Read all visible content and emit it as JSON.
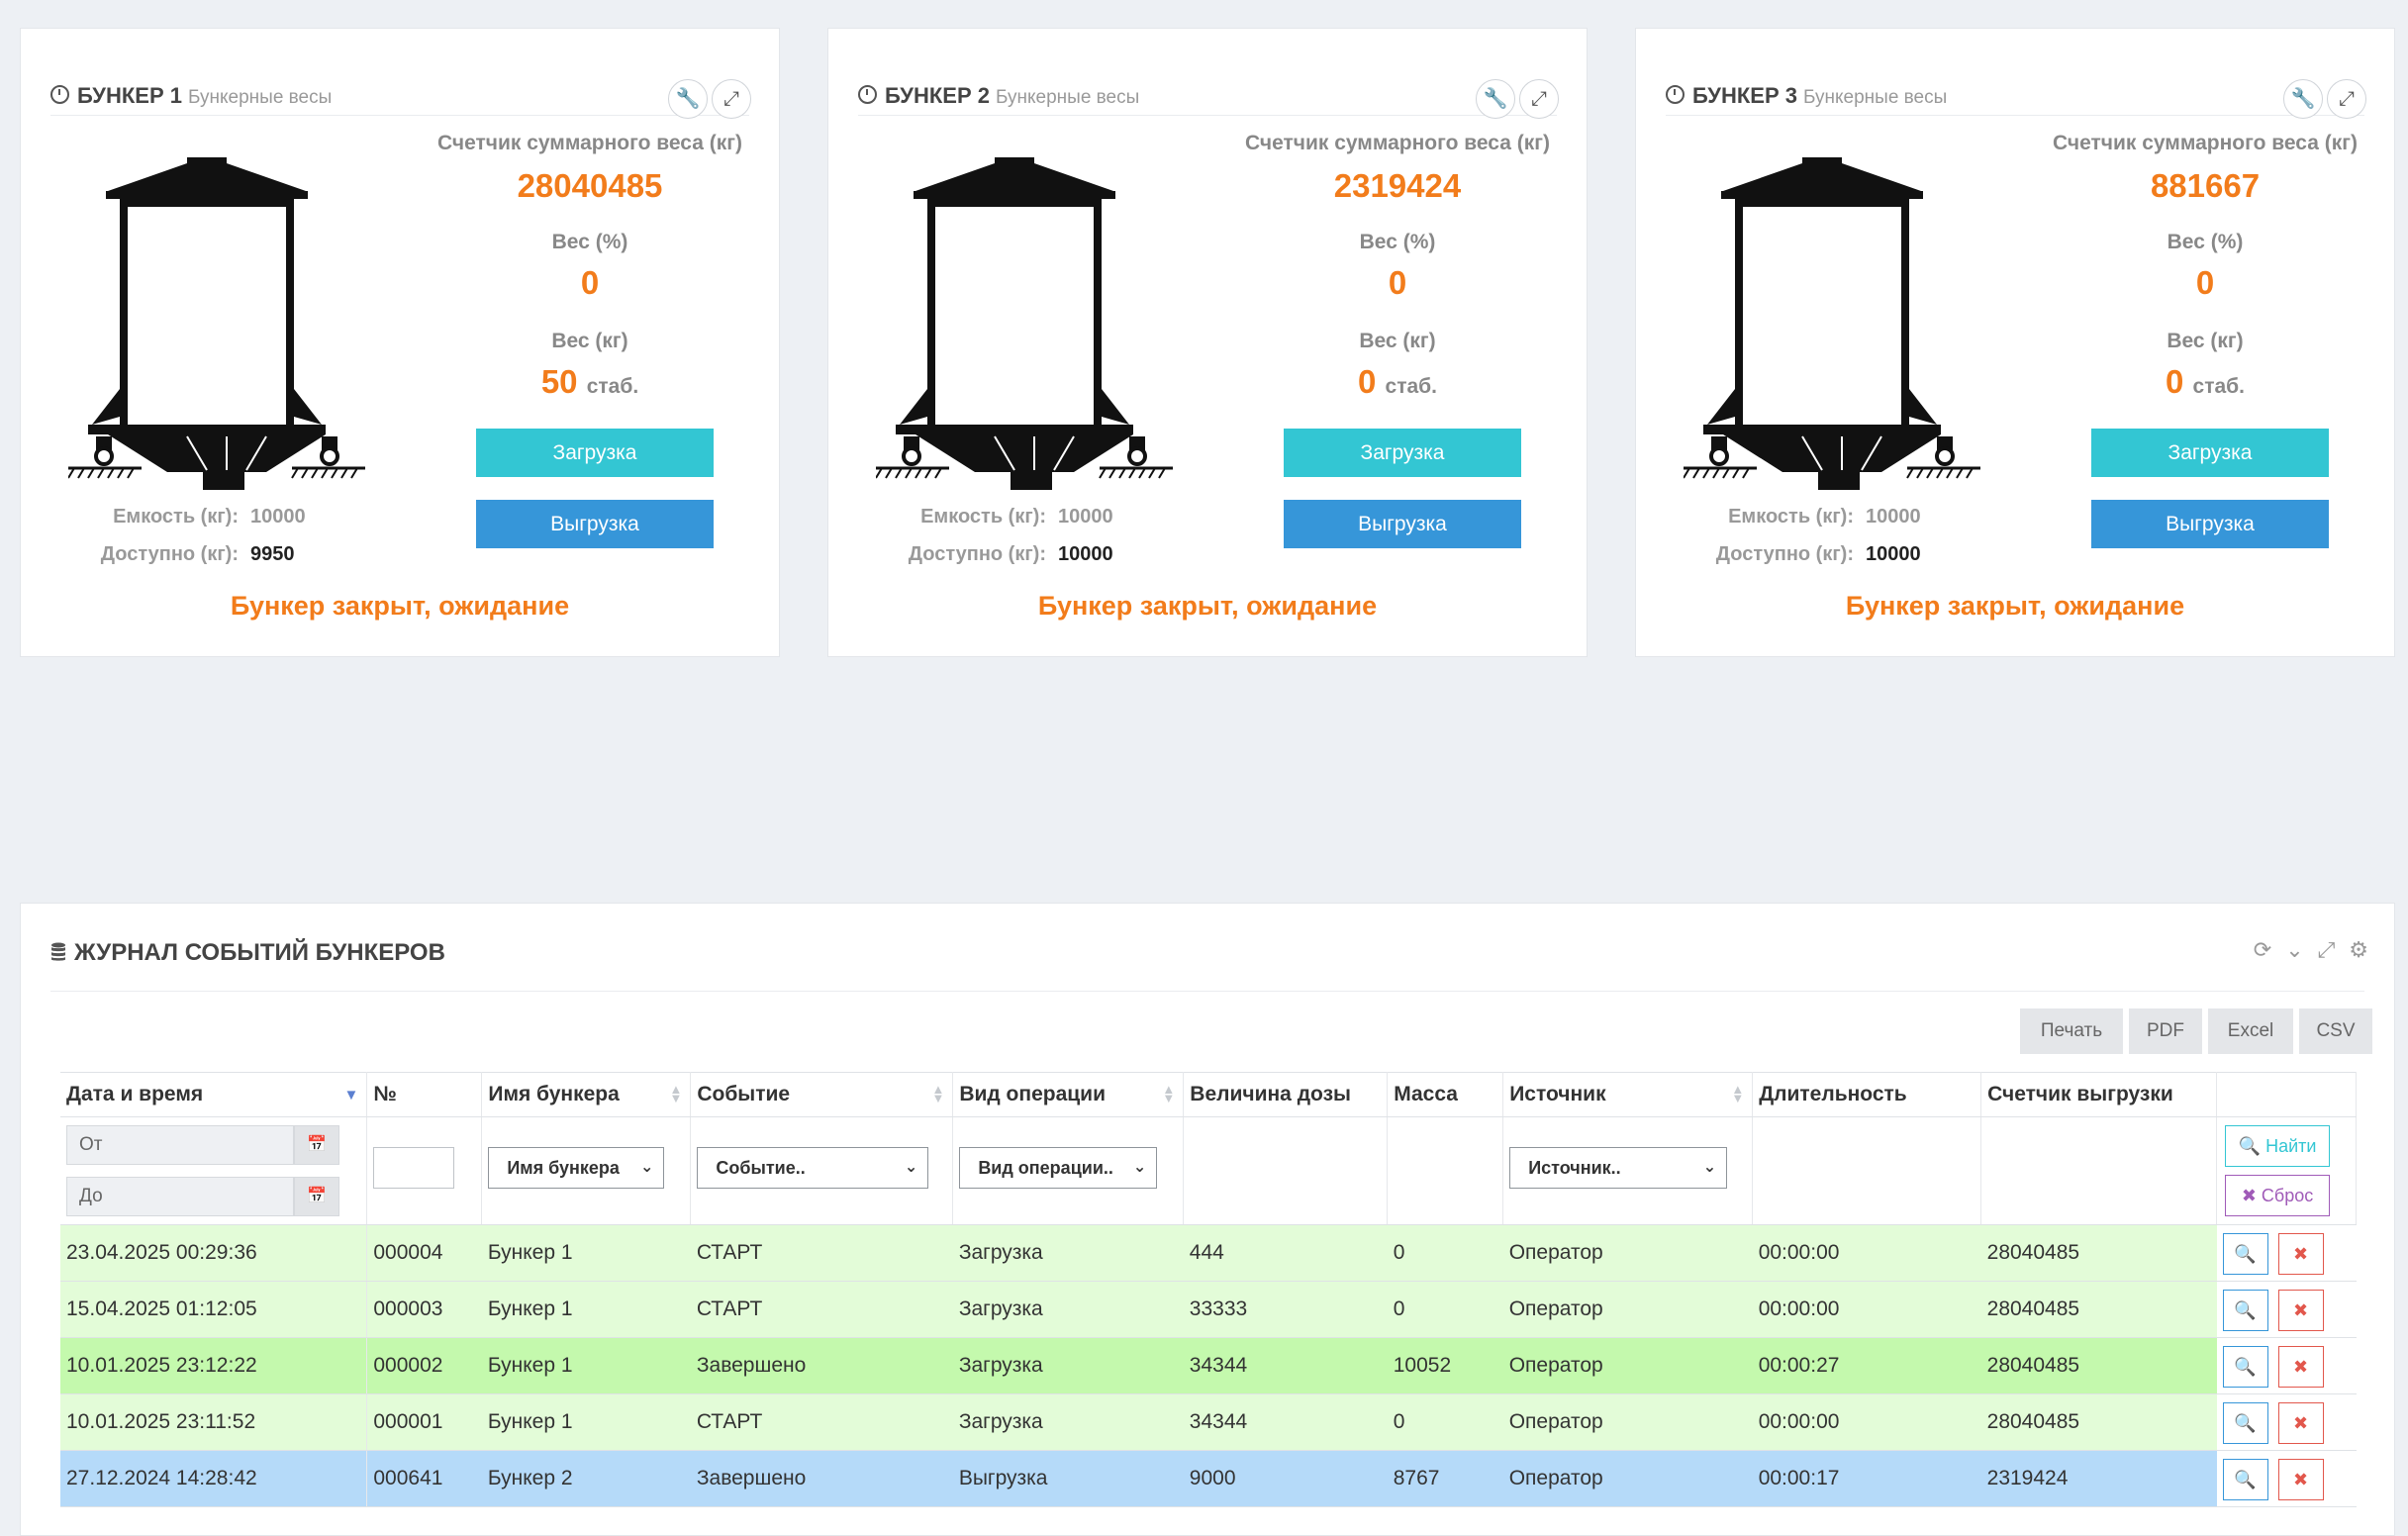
{
  "bunkers": [
    {
      "title": "БУНКЕР 1",
      "subtitle": "Бункерные весы",
      "counter_label": "Счетчик суммарного веса (кг)",
      "counter_value": "28040485",
      "pct_label": "Вес (%)",
      "pct_value": "0",
      "kg_label": "Вес (кг)",
      "kg_value": "50",
      "stab": "стаб.",
      "load_label": "Загрузка",
      "unload_label": "Выгрузка",
      "capacity_label": "Емкость (кг):",
      "capacity_value": "10000",
      "available_label": "Доступно (кг):",
      "available_value": "9950",
      "status": "Бункер закрыт, ожидание"
    },
    {
      "title": "БУНКЕР 2",
      "subtitle": "Бункерные весы",
      "counter_label": "Счетчик суммарного веса (кг)",
      "counter_value": "2319424",
      "pct_label": "Вес (%)",
      "pct_value": "0",
      "kg_label": "Вес (кг)",
      "kg_value": "0",
      "stab": "стаб.",
      "load_label": "Загрузка",
      "unload_label": "Выгрузка",
      "capacity_label": "Емкость (кг):",
      "capacity_value": "10000",
      "available_label": "Доступно (кг):",
      "available_value": "10000",
      "status": "Бункер закрыт, ожидание"
    },
    {
      "title": "БУНКЕР 3",
      "subtitle": "Бункерные весы",
      "counter_label": "Счетчик суммарного веса (кг)",
      "counter_value": "881667",
      "pct_label": "Вес (%)",
      "pct_value": "0",
      "kg_label": "Вес (кг)",
      "kg_value": "0",
      "stab": "стаб.",
      "load_label": "Загрузка",
      "unload_label": "Выгрузка",
      "capacity_label": "Емкость (кг):",
      "capacity_value": "10000",
      "available_label": "Доступно (кг):",
      "available_value": "10000",
      "status": "Бункер закрыт, ожидание"
    }
  ],
  "journal": {
    "title": "ЖУРНАЛ СОБЫТИЙ БУНКЕРОВ",
    "export": {
      "print": "Печать",
      "pdf": "PDF",
      "excel": "Excel",
      "csv": "CSV"
    },
    "columns": [
      "Дата и время",
      "№",
      "Имя бункера",
      "Событие",
      "Вид операции",
      "Величина дозы",
      "Масса",
      "Источник",
      "Длительность",
      "Счетчик выгрузки"
    ],
    "filters": {
      "from_placeholder": "От",
      "to_placeholder": "До",
      "bunker": "Имя бункера",
      "event": "Событие..",
      "operation": "Вид операции..",
      "source": "Источник..",
      "find": "Найти",
      "reset": "Сброс"
    },
    "rows": [
      [
        "23.04.2025 00:29:36",
        "000004",
        "Бункер 1",
        "СТАРТ",
        "Загрузка",
        "444",
        "0",
        "Оператор",
        "00:00:00",
        "28040485"
      ],
      [
        "15.04.2025 01:12:05",
        "000003",
        "Бункер 1",
        "СТАРТ",
        "Загрузка",
        "33333",
        "0",
        "Оператор",
        "00:00:00",
        "28040485"
      ],
      [
        "10.01.2025 23:12:22",
        "000002",
        "Бункер 1",
        "Завершено",
        "Загрузка",
        "34344",
        "10052",
        "Оператор",
        "00:00:27",
        "28040485"
      ],
      [
        "10.01.2025 23:11:52",
        "000001",
        "Бункер 1",
        "СТАРТ",
        "Загрузка",
        "34344",
        "0",
        "Оператор",
        "00:00:00",
        "28040485"
      ],
      [
        "27.12.2024 14:28:42",
        "000641",
        "Бункер 2",
        "Завершено",
        "Выгрузка",
        "9000",
        "8767",
        "Оператор",
        "00:00:17",
        "2319424"
      ]
    ]
  },
  "colors": {
    "accent_orange": "#f27c1b",
    "load_button": "#33c6d3",
    "unload_button": "#3696d9",
    "row_start": "#e3fcd8",
    "row_done_load": "#c4f9ad",
    "row_unload": "#b5daf9"
  }
}
